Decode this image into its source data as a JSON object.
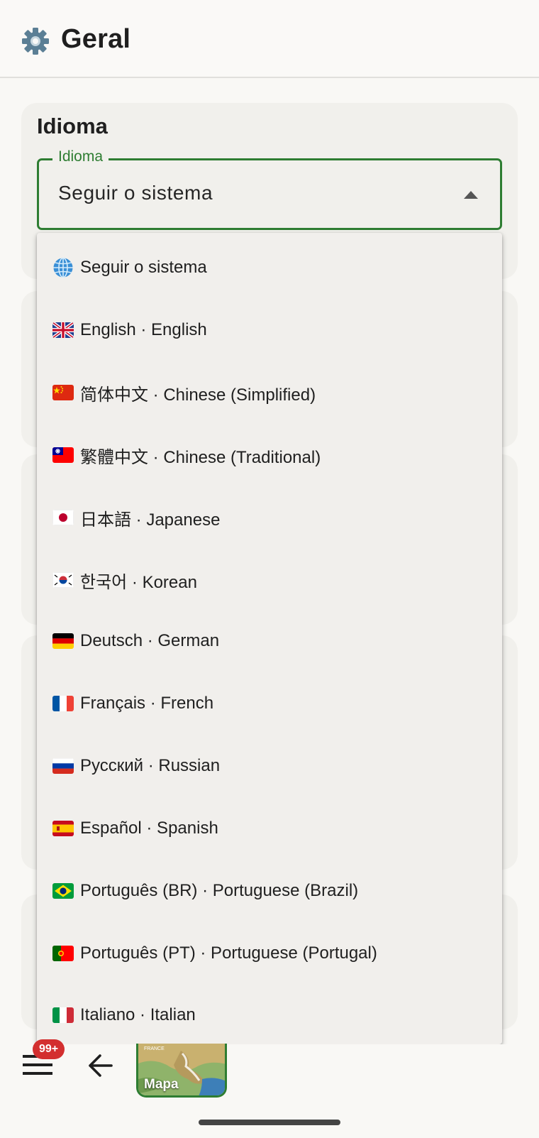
{
  "header": {
    "icon": "gear-icon",
    "title": "Geral"
  },
  "section": {
    "title": "Idioma"
  },
  "select": {
    "legend": "Idioma",
    "value": "Seguir o sistema",
    "accent_color": "#2e7d32",
    "expanded": true
  },
  "menu": {
    "items": [
      {
        "icon": "globe-icon",
        "label": "Seguir o sistema"
      },
      {
        "icon": "flag-uk-icon",
        "label": "English · English"
      },
      {
        "icon": "flag-china-icon",
        "label": "简体中文 · Chinese (Simplified)"
      },
      {
        "icon": "flag-taiwan-icon",
        "label": "繁體中文 · Chinese (Traditional)"
      },
      {
        "icon": "flag-japan-icon",
        "label": "日本語 · Japanese"
      },
      {
        "icon": "flag-korea-icon",
        "label": "한국어 · Korean"
      },
      {
        "icon": "flag-germany-icon",
        "label": "Deutsch · German"
      },
      {
        "icon": "flag-france-icon",
        "label": "Français · French"
      },
      {
        "icon": "flag-russia-icon",
        "label": "Русский · Russian"
      },
      {
        "icon": "flag-spain-icon",
        "label": "Español · Spanish"
      },
      {
        "icon": "flag-brazil-icon",
        "label": "Português (BR) · Portuguese (Brazil)"
      },
      {
        "icon": "flag-portugal-icon",
        "label": "Português (PT) · Portuguese (Portugal)"
      },
      {
        "icon": "flag-italy-icon",
        "label": "Italiano · Italian"
      }
    ]
  },
  "bottom_bar": {
    "menu_icon": "hamburger-menu-icon",
    "badge": "99+",
    "badge_color": "#d32f2f",
    "back_icon": "arrow-left-icon",
    "map_label": "Mapa",
    "map_small_text": "FRANCE"
  }
}
